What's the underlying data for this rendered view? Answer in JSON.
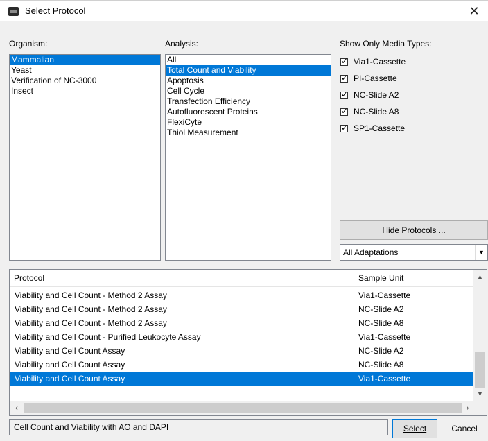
{
  "window": {
    "title": "Select Protocol",
    "close_glyph": "✕",
    "icon": "app-window-icon"
  },
  "organism": {
    "label": "Organism:",
    "items": [
      "Mammalian",
      "Yeast",
      "Verification of NC-3000",
      "Insect"
    ],
    "selected_index": 0
  },
  "analysis": {
    "label": "Analysis:",
    "items": [
      "All",
      "Total Count and Viability",
      "Apoptosis",
      "Cell Cycle",
      "Transfection Efficiency",
      "Autofluorescent Proteins",
      "FlexiCyte",
      "Thiol Measurement"
    ],
    "selected_index": 1
  },
  "media": {
    "label": "Show Only Media Types:",
    "items": [
      {
        "label": "Via1-Cassette",
        "checked": true
      },
      {
        "label": "PI-Cassette",
        "checked": true
      },
      {
        "label": "NC-Slide A2",
        "checked": true
      },
      {
        "label": "NC-Slide A8",
        "checked": true
      },
      {
        "label": "SP1-Cassette",
        "checked": true
      }
    ]
  },
  "hide_protocols_button": "Hide Protocols ...",
  "adaptations": {
    "selected": "All Adaptations"
  },
  "protocol_table": {
    "headers": {
      "protocol": "Protocol",
      "sample_unit": "Sample Unit"
    },
    "rows": [
      {
        "protocol": "Viability and Cell Count - Method 2 Assay",
        "unit": "Via1-Cassette"
      },
      {
        "protocol": "Viability and Cell Count - Method 2 Assay",
        "unit": "NC-Slide A2"
      },
      {
        "protocol": "Viability and Cell Count - Method 2 Assay",
        "unit": "NC-Slide A8"
      },
      {
        "protocol": "Viability and Cell Count - Purified Leukocyte Assay",
        "unit": "Via1-Cassette"
      },
      {
        "protocol": "Viability and Cell Count Assay",
        "unit": "NC-Slide A2"
      },
      {
        "protocol": "Viability and Cell Count Assay",
        "unit": "NC-Slide A8"
      },
      {
        "protocol": "Viability and Cell Count Assay",
        "unit": "Via1-Cassette"
      }
    ],
    "selected_index": 6
  },
  "status_text": "Cell Count and Viability with AO and DAPI",
  "buttons": {
    "select": "Select",
    "cancel": "Cancel"
  },
  "colors": {
    "selection": "#0078d7",
    "window_bg": "#f0f0f0"
  }
}
